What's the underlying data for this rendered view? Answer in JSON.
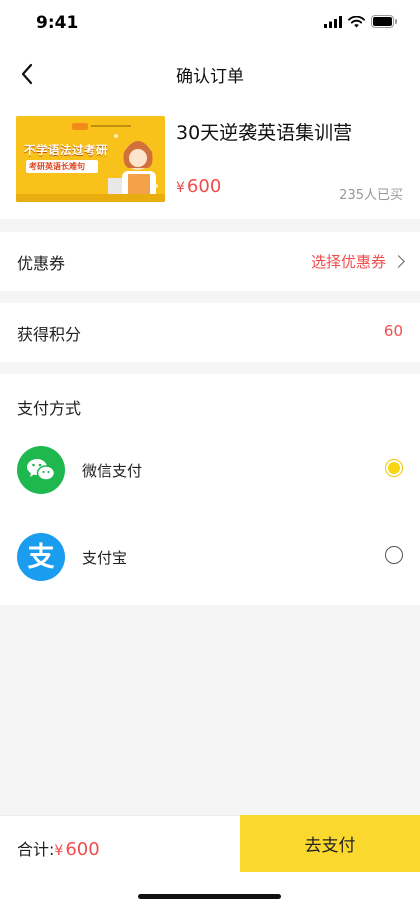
{
  "status_bar": {
    "time": "9:41"
  },
  "nav": {
    "title": "确认订单"
  },
  "product": {
    "image_text_main": "不学语法过考研",
    "image_text_sub": "考研英语长难句",
    "title": "30天逆袭英语集训营",
    "currency": "¥",
    "price": "600",
    "sold": "235人已买"
  },
  "coupon": {
    "label": "优惠券",
    "value": "选择优惠券"
  },
  "points": {
    "label": "获得积分",
    "value": "60"
  },
  "payment": {
    "title": "支付方式",
    "methods": [
      {
        "label": "微信支付",
        "icon": "wechat-pay-icon",
        "color": "#1fb84f",
        "selected": true
      },
      {
        "label": "支付宝",
        "icon": "alipay-icon",
        "color": "#1a9cef",
        "selected": false
      }
    ]
  },
  "footer": {
    "total_label": "合计:",
    "currency": "¥",
    "total_amount": "600",
    "pay_button": "去支付"
  },
  "colors": {
    "accent": "#fbd82e",
    "price_red": "#f04d4d"
  }
}
